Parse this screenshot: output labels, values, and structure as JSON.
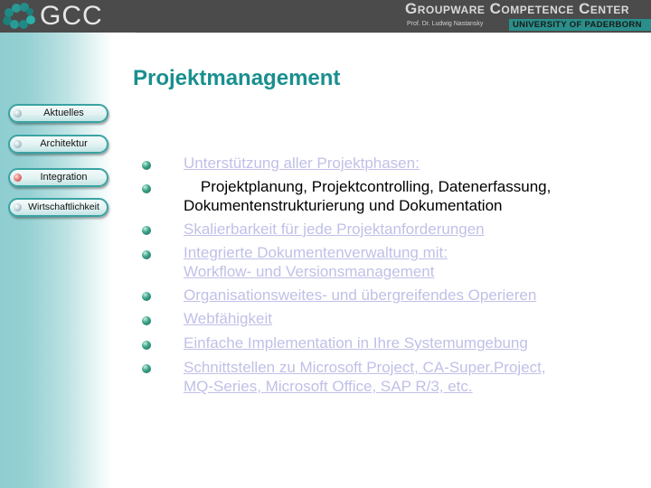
{
  "header": {
    "logo_text": "GCC",
    "center_title": "Groupware Competence Center",
    "professor": "Prof. Dr. Ludwig Nastansky",
    "university": "UNIVERSITY OF PADERBORN"
  },
  "sidebar": {
    "items": [
      {
        "label": "Aktuelles",
        "active": false
      },
      {
        "label": "Architektur",
        "active": false
      },
      {
        "label": "Integration",
        "active": true
      },
      {
        "label": "Wirtschaftlichkeit",
        "active": false
      }
    ]
  },
  "main": {
    "title": "Projektmanagement",
    "bullets": [
      {
        "lines": [
          "Unterstützung aller Projektphasen:"
        ],
        "style": "link"
      },
      {
        "lines": [
          "    Projektplanung, Projektcontrolling, Datenerfassung,",
          "Dokumentenstrukturierung und Dokumentation"
        ],
        "style": "plain"
      },
      {
        "lines": [
          "Skalierbarkeit für jede Projektanforderungen"
        ],
        "style": "link"
      },
      {
        "lines": [
          "Integrierte Dokumentenverwaltung mit:",
          "Workflow- und Versionsmanagement"
        ],
        "style": "link"
      },
      {
        "lines": [
          "Organisationsweites- und übergreifendes Operieren"
        ],
        "style": "link"
      },
      {
        "lines": [
          "Webfähigkeit"
        ],
        "style": "link"
      },
      {
        "lines": [
          "Einfache Implementation in Ihre Systemumgebung"
        ],
        "style": "link"
      },
      {
        "lines": [
          "Schnittstellen zu Microsoft Project, CA-Super.Project,",
          "MQ-Series, Microsoft Office, SAP R/3, etc."
        ],
        "style": "link"
      }
    ]
  },
  "colors": {
    "accent": "#1a8f8f",
    "link": "#c0c0e8",
    "header_bg": "#4b4b4b"
  }
}
